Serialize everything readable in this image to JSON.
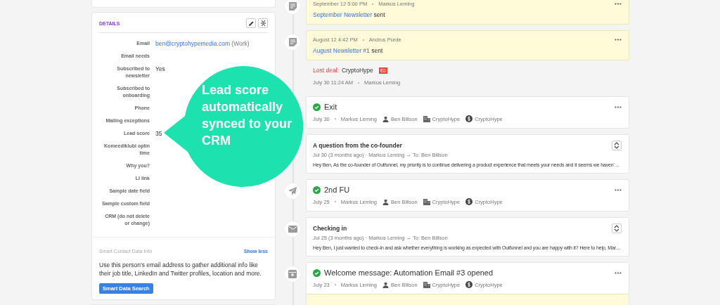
{
  "details": {
    "title": "DETAILS",
    "fields": [
      {
        "label": "Email",
        "kind": "link",
        "value": "ben@cryptohypemedia.com",
        "note": "(Work)"
      },
      {
        "label": "Email needs"
      },
      {
        "label": "Subscribed to newsletter",
        "kind": "text",
        "value": "Yes"
      },
      {
        "label": "Subscribed to onboarding"
      },
      {
        "label": "Phone"
      },
      {
        "label": "Mailing exceptions"
      },
      {
        "label": "Lead score",
        "kind": "text",
        "value": "35"
      },
      {
        "label": "Komeediklubi optin time"
      },
      {
        "label": "Why you?"
      },
      {
        "label": "LI link"
      },
      {
        "label": "Sample date field"
      },
      {
        "label": "Sample custom field"
      },
      {
        "label": "CRM (do not delete or change)"
      }
    ],
    "smart": {
      "title": "Smart Contact Data Info",
      "toggle": "Show less",
      "description": "Use this person's email address to gather additional info like their job title, LinkedIn and Twitter profiles, location and more.",
      "button": "Smart Data Search"
    }
  },
  "callout": {
    "text": "Lead score automatically synced to your CRM"
  },
  "timeline": [
    {
      "kind": "note",
      "date": "September 12 5:00 PM",
      "author": "Markus Leming",
      "link": "September Newsletter",
      "text": "sent"
    },
    {
      "kind": "note",
      "date": "August 12 4:42 PM",
      "author": "Andrus Purde",
      "link": "August Newsletter #1",
      "text": "sent"
    },
    {
      "kind": "deal",
      "status": "Lost deal:",
      "name": "CryptoHype",
      "amount": "€0",
      "date": "July 30 11:24 AM",
      "author": "Markus Leming"
    },
    {
      "kind": "activity",
      "done": true,
      "title": "Exit",
      "date": "July 30",
      "author": "Markus Leming",
      "person": "Ben Billson",
      "org": "CryptoHype",
      "deal": "CryptoHype"
    },
    {
      "kind": "email",
      "subject": "A question from the co-founder",
      "meta": "Jul 30 (3 months ago) · Markus Leming → To: Ben Billson",
      "snippet": "Hey Ben, As the co-founder of Outfunnel, my priority is to continue delivering a product experience that meets your needs and it seems we haven'…"
    },
    {
      "kind": "activity",
      "done": true,
      "title": "2nd FU",
      "date": "July 25",
      "author": "Markus Leming",
      "person": "Ben Billson",
      "org": "CryptoHype",
      "deal": "CryptoHype"
    },
    {
      "kind": "email",
      "subject": "Checking in",
      "meta": "Jul 25 (3 months ago) · Markus Leming → To: Ben Billson",
      "snippet": "Hey Ben, I just wanted to check-in and ask whether everything is working as expected with Outfunnel and you are happy with it? Here to help, Mar…"
    },
    {
      "kind": "activity",
      "done": true,
      "title": "Welcome message: Automation Email #3 opened",
      "date": "July 23",
      "author": "Markus Leming",
      "person": "Ben Billson",
      "org": "CryptoHype",
      "deal": "CryptoHype",
      "strip": true
    }
  ]
}
